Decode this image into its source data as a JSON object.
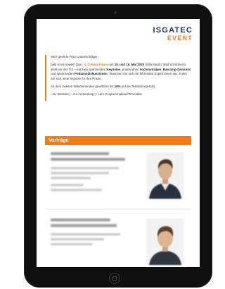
{
  "logo": {
    "main": "ISGATEC",
    "sub": "EVENT"
  },
  "intro": {
    "greeting": "Sehr geehrte Frau Lautenschläger,",
    "p1_a": "bald ist es soweit! Das ",
    "p1_event": "› 4. O-Ring-Forum",
    "p1_b": " am ",
    "p1_dates": "15. und 16. Mai 2025",
    "p1_c": " (Villa Medici, Bad Schönborn) steht vor der Tür – mit zwei spannenden ",
    "p1_keynotes": "Keynotes",
    "p1_d": ", praxisnahen ",
    "p1_fach": "Fachvorträgen",
    "p1_e": ", ",
    "p1_barcamp": "Barcamp-Sessions",
    "p1_f": " und spannenden ",
    "p1_podium": "Podiumsdiskussionen",
    "p1_g": ". Tauschen Sie sich mit führenden Expert:innen aus, holen Sie sich neue Impulse für Ihre Praxis.",
    "p2_a": "Ab dem zweiten Teilnehmenden gewähren wir ",
    "p2_pct": "10%",
    "p2_b": " auf die Teilnahmegebühr.",
    "links": "› zur Website | › zur Anmeldung | › zum Programmablauf/Timetable"
  },
  "section": {
    "title": "Vorträge"
  }
}
